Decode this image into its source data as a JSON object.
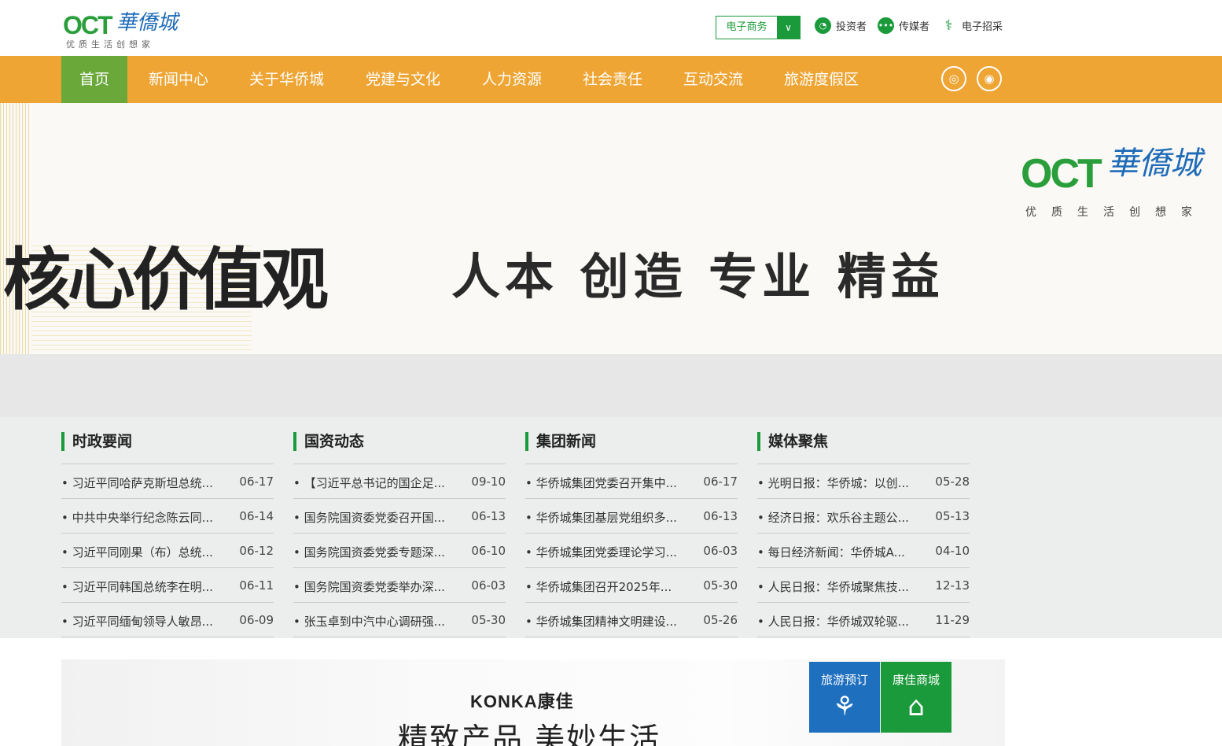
{
  "header": {
    "logo_text": "OCT",
    "logo_cn": "華僑城",
    "logo_slogan": "优质生活创想家",
    "ecommerce_label": "电子商务",
    "links": [
      {
        "label": "投资者",
        "icon": "investor-icon"
      },
      {
        "label": "传媒者",
        "icon": "media-icon"
      },
      {
        "label": "电子招采",
        "icon": "procurement-icon"
      }
    ]
  },
  "nav": {
    "items": [
      "首页",
      "新闻中心",
      "关于华侨城",
      "党建与文化",
      "人力资源",
      "社会责任",
      "互动交流",
      "旅游度假区"
    ],
    "social": [
      "weibo-icon",
      "wechat-icon"
    ]
  },
  "banner": {
    "logo_text": "OCT",
    "logo_cn": "華僑城",
    "logo_slogan": "优质生活创想家",
    "title": "核心价值观",
    "values": "人本 创造 专业 精益"
  },
  "news": {
    "columns": [
      {
        "title": "时政要闻",
        "items": [
          {
            "text": "习近平同哈萨克斯坦总统...",
            "date": "06-17"
          },
          {
            "text": "中共中央举行纪念陈云同...",
            "date": "06-14"
          },
          {
            "text": "习近平同刚果（布）总统...",
            "date": "06-12"
          },
          {
            "text": "习近平同韩国总统李在明...",
            "date": "06-11"
          },
          {
            "text": "习近平同缅甸领导人敏昂...",
            "date": "06-09"
          }
        ]
      },
      {
        "title": "国资动态",
        "items": [
          {
            "text": "【习近平总书记的国企足...",
            "date": "09-10"
          },
          {
            "text": "国务院国资委党委召开国...",
            "date": "06-13"
          },
          {
            "text": "国务院国资委党委专题深...",
            "date": "06-10"
          },
          {
            "text": "国务院国资委党委举办深...",
            "date": "06-03"
          },
          {
            "text": "张玉卓到中汽中心调研强...",
            "date": "05-30"
          }
        ]
      },
      {
        "title": "集团新闻",
        "items": [
          {
            "text": "华侨城集团党委召开集中...",
            "date": "06-17"
          },
          {
            "text": "华侨城集团基层党组织多...",
            "date": "06-13"
          },
          {
            "text": "华侨城集团党委理论学习...",
            "date": "06-03"
          },
          {
            "text": "华侨城集团召开2025年...",
            "date": "05-30"
          },
          {
            "text": "华侨城集团精神文明建设...",
            "date": "05-26"
          }
        ]
      },
      {
        "title": "媒体聚焦",
        "items": [
          {
            "text": "光明日报：华侨城：以创...",
            "date": "05-28"
          },
          {
            "text": "经济日报：欢乐谷主题公...",
            "date": "05-13"
          },
          {
            "text": "每日经济新闻：华侨城A...",
            "date": "04-10"
          },
          {
            "text": "人民日报：华侨城聚焦技...",
            "date": "12-13"
          },
          {
            "text": "人民日报：华侨城双轮驱...",
            "date": "11-29"
          }
        ]
      }
    ]
  },
  "promo": {
    "brand": "KONKA康佳",
    "slogan": "精致产品 美妙生活"
  },
  "tiles": [
    {
      "label": "旅游预订",
      "color": "#1f6fbf",
      "icon": "island-icon"
    },
    {
      "label": "康佳商城",
      "color": "#1a9a3a",
      "icon": "shop-icon"
    }
  ],
  "colors": {
    "accent": "#1a9a3a",
    "nav": "#eea534",
    "home": "#6aa83a"
  }
}
